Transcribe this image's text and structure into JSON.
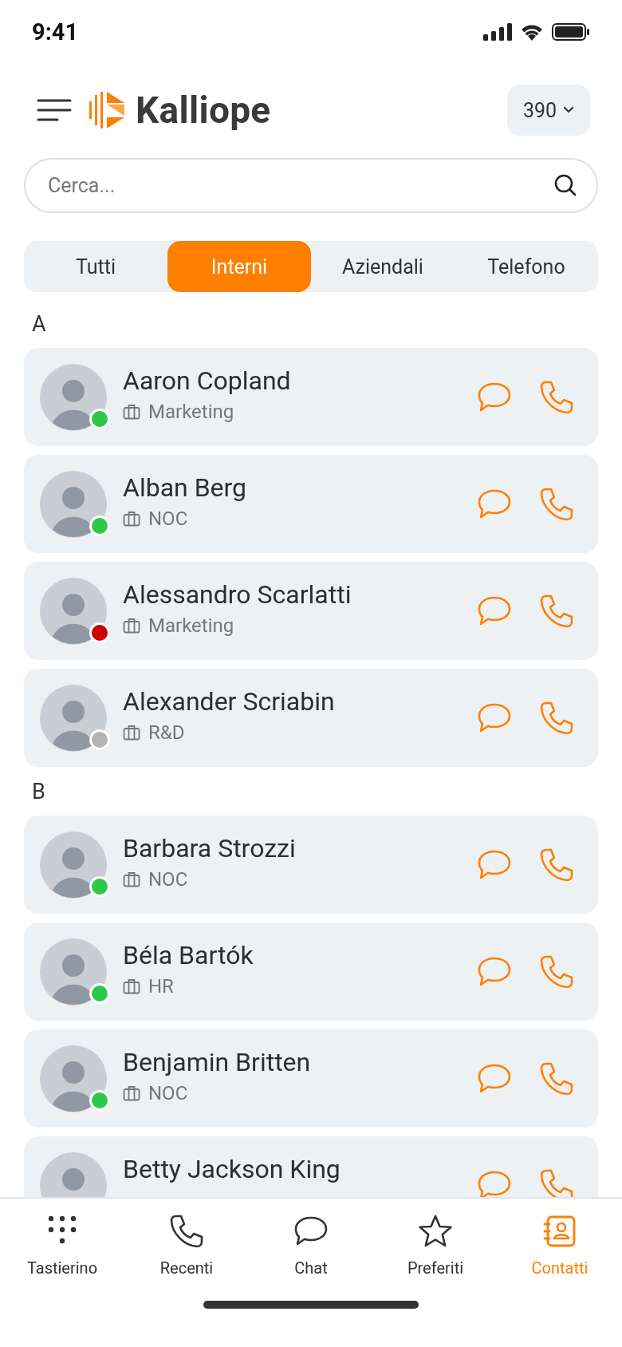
{
  "status_bar": {
    "time": "9:41"
  },
  "header": {
    "app_name": "Kalliope",
    "extension": "390"
  },
  "search": {
    "placeholder": "Cerca..."
  },
  "tabs": [
    {
      "label": "Tutti",
      "selected": false
    },
    {
      "label": "Interni",
      "selected": true
    },
    {
      "label": "Aziendali",
      "selected": false
    },
    {
      "label": "Telefono",
      "selected": false
    }
  ],
  "sections": [
    {
      "letter": "A",
      "contacts": [
        {
          "name": "Aaron Copland",
          "department": "Marketing",
          "color": "#2ec84a"
        },
        {
          "name": "Alban Berg",
          "department": "NOC",
          "color": "#2ec84a"
        },
        {
          "name": "Alessandro Scarlatti",
          "department": "Marketing",
          "color": "#cc0000"
        },
        {
          "name": "Alexander Scriabin",
          "department": "R&D",
          "color": "#b4b4b4"
        }
      ]
    },
    {
      "letter": "B",
      "contacts": [
        {
          "name": "Barbara Strozzi",
          "department": "NOC",
          "color": "#2ec84a"
        },
        {
          "name": "Béla Bartók",
          "department": "HR",
          "color": "#2ec84a"
        },
        {
          "name": "Benjamin Britten",
          "department": "NOC",
          "color": "#2ec84a"
        },
        {
          "name": "Betty Jackson King"
        }
      ]
    }
  ],
  "bottom_nav": [
    {
      "label": "Tastierino",
      "kind": "keypad",
      "selected": false
    },
    {
      "label": "Recenti",
      "kind": "calls",
      "selected": false
    },
    {
      "label": "Chat",
      "kind": "chat",
      "selected": false
    },
    {
      "label": "Preferiti",
      "kind": "favorites",
      "selected": false
    },
    {
      "label": "Contatti",
      "kind": "contacts",
      "selected": true
    }
  ]
}
